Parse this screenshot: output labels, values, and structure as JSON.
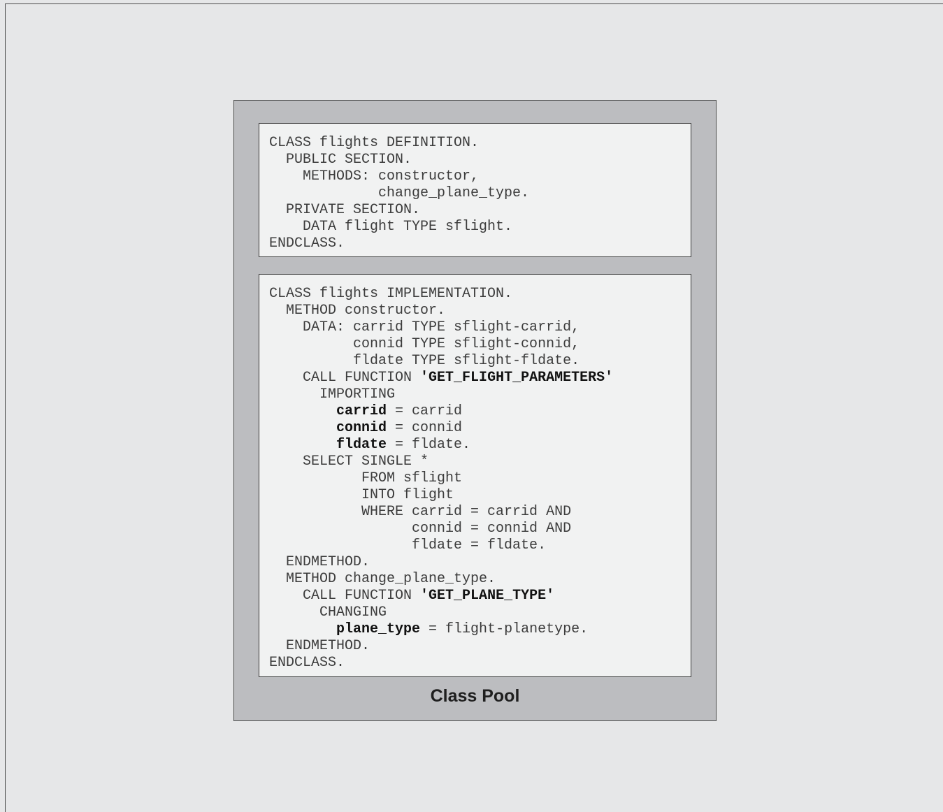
{
  "class_pool": {
    "label": "Class Pool",
    "definition_lines": [
      [
        {
          "t": "CLASS flights DEFINITION."
        }
      ],
      [
        {
          "t": "  PUBLIC SECTION."
        }
      ],
      [
        {
          "t": "    METHODS: constructor,"
        }
      ],
      [
        {
          "t": "             change_plane_type."
        }
      ],
      [
        {
          "t": "  PRIVATE SECTION."
        }
      ],
      [
        {
          "t": "    DATA flight TYPE sflight."
        }
      ],
      [
        {
          "t": "ENDCLASS."
        }
      ]
    ],
    "implementation_lines": [
      [
        {
          "t": "CLASS flights IMPLEMENTATION."
        }
      ],
      [
        {
          "t": "  METHOD constructor."
        }
      ],
      [
        {
          "t": "    DATA: carrid TYPE sflight-carrid,"
        }
      ],
      [
        {
          "t": "          connid TYPE sflight-connid,"
        }
      ],
      [
        {
          "t": "          fldate TYPE sflight-fldate."
        }
      ],
      [
        {
          "t": "    CALL FUNCTION "
        },
        {
          "t": "'GET_FLIGHT_PARAMETERS'",
          "b": true
        }
      ],
      [
        {
          "t": "      IMPORTING"
        }
      ],
      [
        {
          "t": "        "
        },
        {
          "t": "carrid",
          "b": true
        },
        {
          "t": " = carrid"
        }
      ],
      [
        {
          "t": "        "
        },
        {
          "t": "connid",
          "b": true
        },
        {
          "t": " = connid"
        }
      ],
      [
        {
          "t": "        "
        },
        {
          "t": "fldate",
          "b": true
        },
        {
          "t": " = fldate."
        }
      ],
      [
        {
          "t": "    SELECT SINGLE *"
        }
      ],
      [
        {
          "t": "           FROM sflight"
        }
      ],
      [
        {
          "t": "           INTO flight"
        }
      ],
      [
        {
          "t": "           WHERE carrid = carrid AND"
        }
      ],
      [
        {
          "t": "                 connid = connid AND"
        }
      ],
      [
        {
          "t": "                 fldate = fldate."
        }
      ],
      [
        {
          "t": "  ENDMETHOD."
        }
      ],
      [
        {
          "t": "  METHOD change_plane_type."
        }
      ],
      [
        {
          "t": "    CALL FUNCTION "
        },
        {
          "t": "'GET_PLANE_TYPE'",
          "b": true
        }
      ],
      [
        {
          "t": "      CHANGING"
        }
      ],
      [
        {
          "t": "        "
        },
        {
          "t": "plane_type",
          "b": true
        },
        {
          "t": " = flight-planetype."
        }
      ],
      [
        {
          "t": "  ENDMETHOD."
        }
      ],
      [
        {
          "t": "ENDCLASS."
        }
      ]
    ]
  }
}
